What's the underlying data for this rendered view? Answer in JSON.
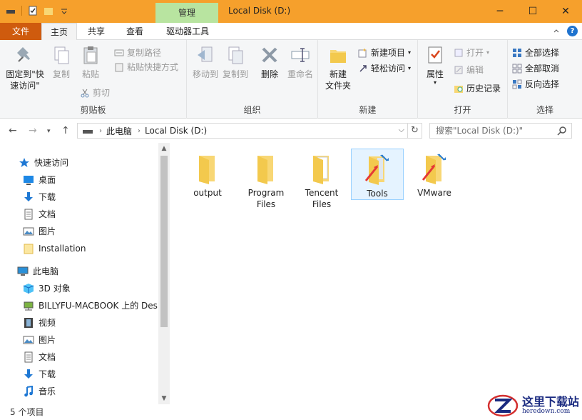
{
  "window": {
    "title": "Local Disk (D:)",
    "context_tab": "管理",
    "minimize": "─",
    "maximize": "☐",
    "close": "✕"
  },
  "tabs": {
    "file": "文件",
    "home": "主页",
    "share": "共享",
    "view": "查看",
    "drive_tools": "驱动器工具"
  },
  "ribbon": {
    "clipboard": {
      "label": "剪贴板",
      "pin_quick_line1": "固定到\"快",
      "pin_quick_line2": "速访问\"",
      "copy": "复制",
      "paste": "粘贴",
      "copy_path": "复制路径",
      "paste_shortcut": "粘贴快捷方式",
      "cut": "剪切"
    },
    "organize": {
      "label": "组织",
      "move_to": "移动到",
      "copy_to": "复制到",
      "delete": "删除",
      "rename": "重命名"
    },
    "new": {
      "label": "新建",
      "new_folder_line1": "新建",
      "new_folder_line2": "文件夹",
      "new_item": "新建项目",
      "easy_access": "轻松访问"
    },
    "open": {
      "label": "打开",
      "properties": "属性",
      "open": "打开",
      "edit": "编辑",
      "history": "历史记录"
    },
    "select": {
      "label": "选择",
      "select_all": "全部选择",
      "select_none": "全部取消",
      "invert": "反向选择"
    }
  },
  "address": {
    "this_pc": "此电脑",
    "drive": "Local Disk (D:)",
    "search_placeholder": "搜索\"Local Disk (D:)\""
  },
  "nav": {
    "quick_access": "快速访问",
    "desktop": "桌面",
    "downloads": "下载",
    "documents": "文档",
    "pictures": "图片",
    "installation": "Installation",
    "this_pc": "此电脑",
    "objects3d": "3D 对象",
    "mac_desktop": "BILLYFU-MACBOOK 上的 Des",
    "videos": "视频",
    "pictures2": "图片",
    "documents2": "文档",
    "downloads2": "下载",
    "music": "音乐"
  },
  "files": [
    {
      "line1": "output",
      "line2": ""
    },
    {
      "line1": "Program",
      "line2": "Files"
    },
    {
      "line1": "Tencent",
      "line2": "Files"
    },
    {
      "line1": "Tools",
      "line2": ""
    },
    {
      "line1": "VMware",
      "line2": ""
    }
  ],
  "status": {
    "count": "5 个项目"
  },
  "watermark": {
    "title": "这里下载站",
    "sub": "heredown.com"
  },
  "colors": {
    "titlebar": "#f6a02c",
    "file_tab": "#cf5b0e",
    "context_tab": "#b8e4a0",
    "folder": "#f8d775",
    "selection": "#e5f3ff"
  }
}
